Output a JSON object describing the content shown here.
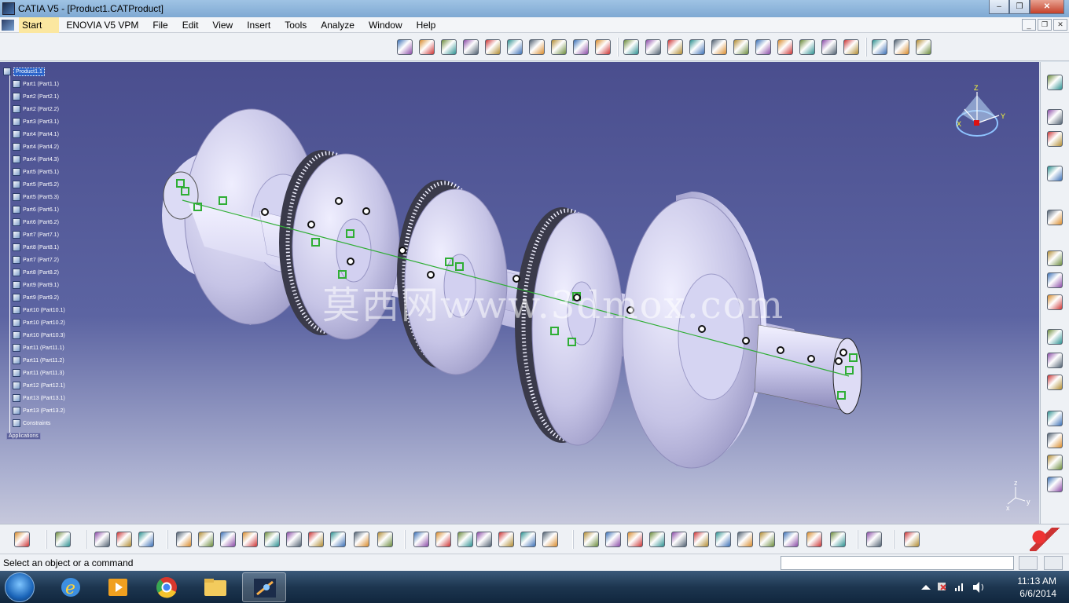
{
  "window": {
    "title": "CATIA V5 - [Product1.CATProduct]",
    "minimize": "–",
    "restore": "❐",
    "close": "✕"
  },
  "menu": {
    "start": "Start",
    "items": [
      "ENOVIA V5 VPM",
      "File",
      "Edit",
      "View",
      "Insert",
      "Tools",
      "Analyze",
      "Window",
      "Help"
    ]
  },
  "tree": {
    "root": "Product1.1",
    "parts": [
      "Part1 (Part1.1)",
      "Part2 (Part2.1)",
      "Part2 (Part2.2)",
      "Part3 (Part3.1)",
      "Part4 (Part4.1)",
      "Part4 (Part4.2)",
      "Part4 (Part4.3)",
      "Part5 (Part5.1)",
      "Part5 (Part5.2)",
      "Part5 (Part5.3)",
      "Part6 (Part6.1)",
      "Part6 (Part6.2)",
      "Part7 (Part7.1)",
      "Part8 (Part8.1)",
      "Part7 (Part7.2)",
      "Part8 (Part8.2)",
      "Part9 (Part9.1)",
      "Part9 (Part9.2)",
      "Part10 (Part10.1)",
      "Part10 (Part10.2)",
      "Part10 (Part10.3)",
      "Part11 (Part11.1)",
      "Part11 (Part11.2)",
      "Part11 (Part11.3)",
      "Part12 (Part12.1)",
      "Part13 (Part13.1)",
      "Part13 (Part13.2)"
    ],
    "constraints": "Constraints",
    "applications": "Applications"
  },
  "viewport": {
    "watermark": "莫西网www.3dmox.com",
    "compass_axes": [
      "X",
      "Y",
      "Z"
    ],
    "mini_axes": [
      "z",
      "x",
      "y"
    ]
  },
  "status": {
    "message": "Select an object or a command",
    "command_placeholder": ""
  },
  "taskbar": {
    "time": "11:13 AM",
    "date": "6/6/2014"
  },
  "colors": {
    "viewport_top": "#4a4e8e",
    "viewport_bottom": "#c6c8dc",
    "model_body": "#c9c7ea",
    "constraint_green": "#2fae35",
    "tree_selected": "#2b63c9"
  },
  "icons": {
    "top_toolbar": [
      "assembly-icon",
      "product-icon",
      "component-icon",
      "shape-icon",
      "fix-icon",
      "sketch-icon",
      "analysis-icon",
      "constraint-icon",
      "update-icon",
      "grid-icon",
      "gear-icon",
      "gear-icon",
      "gear-icon",
      "insert-icon",
      "edit-icon",
      "snap-icon",
      "explode-icon",
      "text-icon",
      "annotation-icon",
      "measure-icon",
      "multiview-icon",
      "catalog-icon",
      "boolean-icon",
      "wizard-icon"
    ],
    "right_toolbar": [
      "gear-icon",
      "copy-icon",
      "paste-icon",
      "move-icon",
      "cursor-icon",
      "replace-icon",
      "structure-icon",
      "reorder-icon",
      "new-component-icon",
      "new-product-icon",
      "new-part-icon",
      "existing-component-icon",
      "save-as-icon",
      "bom-icon",
      "tree-icon"
    ],
    "bottom_toolbar": [
      "camera-icon",
      "grid-icon",
      "snapshot-icon",
      "knowledge-icon",
      "rules-icon",
      "new-icon",
      "open-icon",
      "save-icon",
      "print-icon",
      "cut-icon",
      "copy-icon",
      "paste-icon",
      "undo-icon",
      "redo-icon",
      "whats-this-icon",
      "formula-icon",
      "comment-icon",
      "link-icon",
      "table-icon",
      "tree-icon",
      "lock-icon",
      "filter-icon",
      "fly-icon",
      "fit-all-icon",
      "pan-icon",
      "rotate-icon",
      "zoom-in-icon",
      "zoom-out-icon",
      "normal-view-icon",
      "multi-view-icon",
      "iso-view-icon",
      "render-icon",
      "hide-icon",
      "swap-icon",
      "refresh-icon",
      "3ds-logo-icon"
    ]
  }
}
